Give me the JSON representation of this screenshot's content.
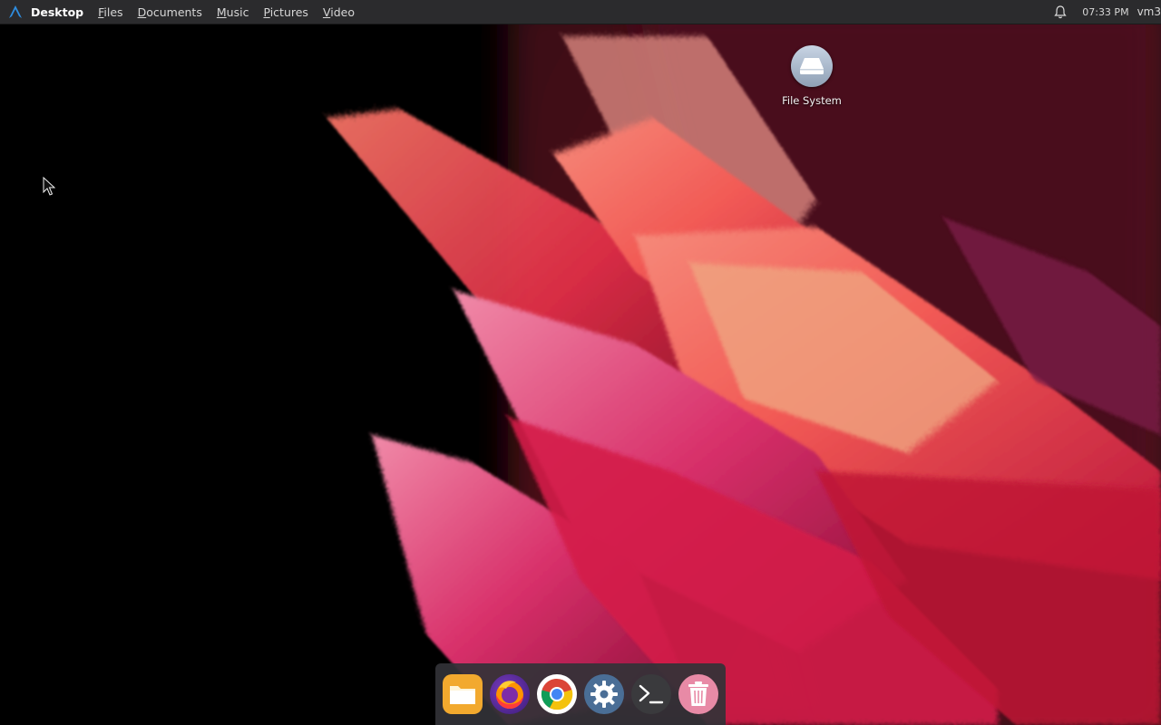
{
  "topbar": {
    "app_name": "Desktop",
    "menu": [
      {
        "mnemonic": "F",
        "rest": "iles"
      },
      {
        "mnemonic": "D",
        "rest": "ocuments"
      },
      {
        "mnemonic": "M",
        "rest": "usic"
      },
      {
        "mnemonic": "P",
        "rest": "ictures"
      },
      {
        "mnemonic": "V",
        "rest": "ideo"
      }
    ],
    "clock": "07:33 PM",
    "user": "vm3"
  },
  "desktop_icons": [
    {
      "label": "File System",
      "icon": "drive-icon"
    }
  ],
  "dock": {
    "items": [
      {
        "name": "files",
        "icon": "folder-icon",
        "color": "#f5a623"
      },
      {
        "name": "firefox",
        "icon": "firefox-icon",
        "color": "#ff7139"
      },
      {
        "name": "chrome",
        "icon": "chrome-icon",
        "color": "#4285f4"
      },
      {
        "name": "settings",
        "icon": "gear-icon",
        "color": "#4a6e96"
      },
      {
        "name": "terminal",
        "icon": "terminal-icon",
        "color": "#333333"
      },
      {
        "name": "trash",
        "icon": "trash-icon",
        "color": "#e88aa6"
      }
    ]
  },
  "colors": {
    "accent": "#2e8de0",
    "topbar_bg": "#2b2b2d"
  }
}
